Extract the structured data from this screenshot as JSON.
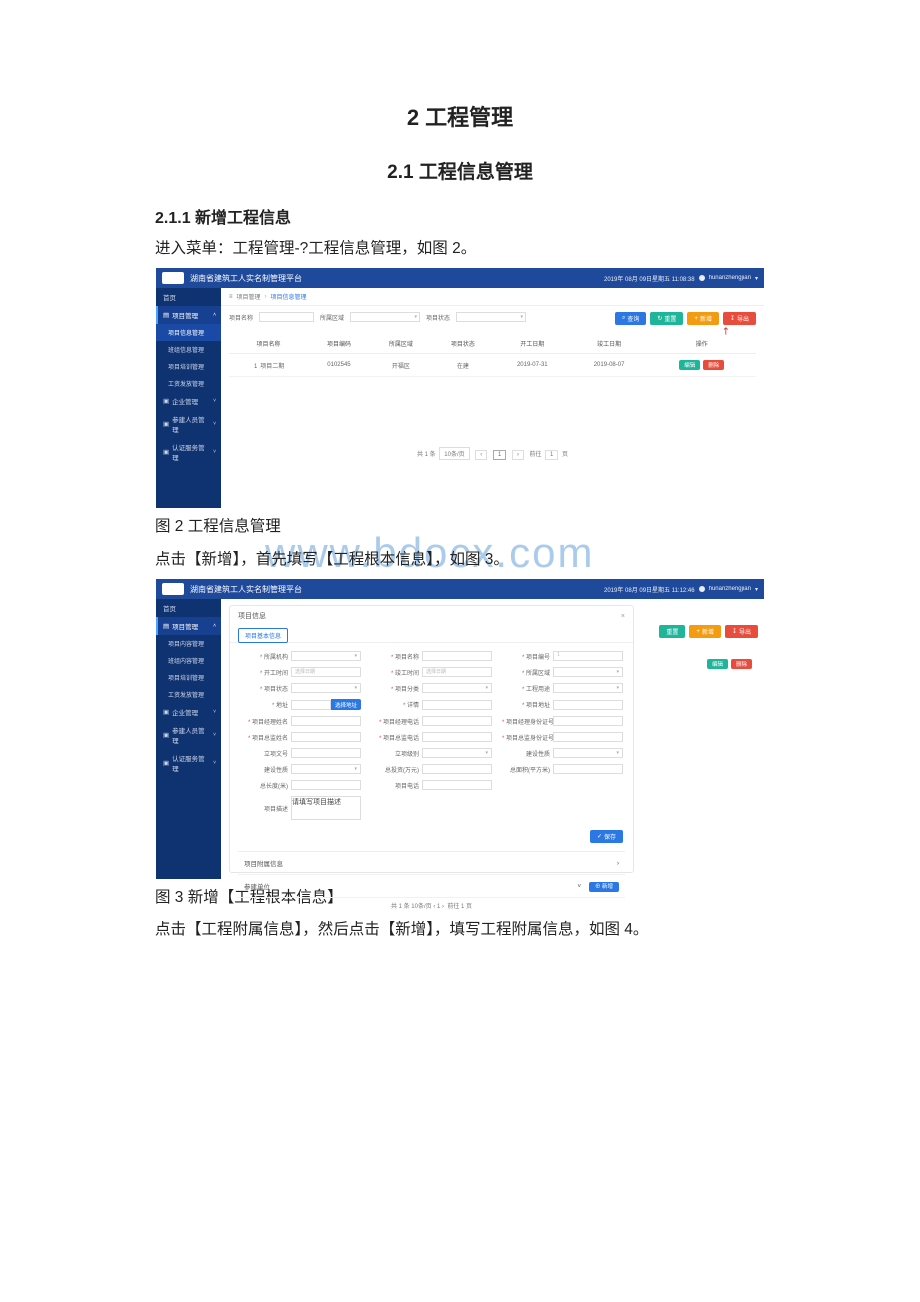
{
  "headings": {
    "h1": "2 工程管理",
    "h2": "2.1 工程信息管理",
    "h3": "2.1.1 新增工程信息"
  },
  "paras": {
    "p1": "进入菜单：工程管理-?工程信息管理，如图 2。",
    "cap2": "图 2 工程信息管理",
    "p2": "点击【新增】，首先填写【工程根本信息】，如图 3。",
    "cap3": "图 3 新增【工程根本信息】",
    "p3": "点击【工程附属信息】，然后点击【新增】，填写工程附属信息，如图 4。"
  },
  "watermark": "www.bdocx.com",
  "app": {
    "title": "湖南省建筑工人实名制管理平台",
    "datetime1": "2019年 08月 09日星期五 11:08:38",
    "datetime2": "2019年 08月 09日星期五 11:12:46",
    "user": "hunanzhengjian"
  },
  "sidebar": {
    "home": "首页",
    "group_project": "项目管理",
    "items1": [
      "项目信息管理",
      "班组信息管理",
      "项目培训管理",
      "工资发放管理"
    ],
    "group_company": "企业管理",
    "group_worker": "参建人员管理",
    "group_device": "认证服务管理",
    "items2": [
      "项目内容管理",
      "班组内容管理",
      "项目培训管理",
      "工资发放管理"
    ]
  },
  "crumb": {
    "a": "项目管理",
    "b": "项目信息管理"
  },
  "filters": {
    "l1": "项目名称",
    "l2": "所属区域",
    "l3": "项目状态"
  },
  "buttons": {
    "search": "查询",
    "reset": "重置",
    "add": "新增",
    "export": "导出"
  },
  "table": {
    "cols": [
      "项目名称",
      "项目编码",
      "所属区域",
      "项目状态",
      "开工日期",
      "竣工日期",
      "操作"
    ],
    "row": [
      "项目二期",
      "0102545",
      "开福区",
      "在建",
      "2019-07-31",
      "2019-08-07"
    ],
    "ops": {
      "edit": "编辑",
      "del": "删除"
    }
  },
  "pager": {
    "total": "共 1 条",
    "per": "10条/页",
    "goto": "前往",
    "page": "1",
    "unit": "页"
  },
  "modal": {
    "title": "项目信息",
    "close": "×",
    "tab": "项目基本信息",
    "fields": {
      "orgName": "所属机构",
      "projectName": "项目名称",
      "projectNo": "项目编号",
      "startDate": "开工时间",
      "endDate": "竣工时间",
      "area": "所属区域",
      "status": "项目状态",
      "category": "项目分类",
      "purpose": "工程用途",
      "address": "地址",
      "addrBtn": "选择地址",
      "detail": "详情",
      "detailAddr": "项目地址",
      "mgrName": "项目经理姓名",
      "mgrPhone": "项目经理电话",
      "mgrId": "项目经理身份证号",
      "safetyName": "项目总监姓名",
      "safetyPhone": "项目总监电话",
      "safetyId": "项目总监身份证号",
      "setupDoc": "立项文号",
      "setupLevel": "立项级别",
      "buildNature": "建设性质",
      "buildType": "建设性质",
      "invest": "总投资(万元)",
      "buildArea": "总面积(平方米)",
      "length": "总长度(米)",
      "contact": "项目电话",
      "desc": "项目描述",
      "descPh": "请填写项目描述"
    },
    "dateHint": "选择日期",
    "saveBtn": "保存",
    "acc1": "项目附属信息",
    "acc2": "参建单位",
    "acc2Btn": "新增"
  }
}
